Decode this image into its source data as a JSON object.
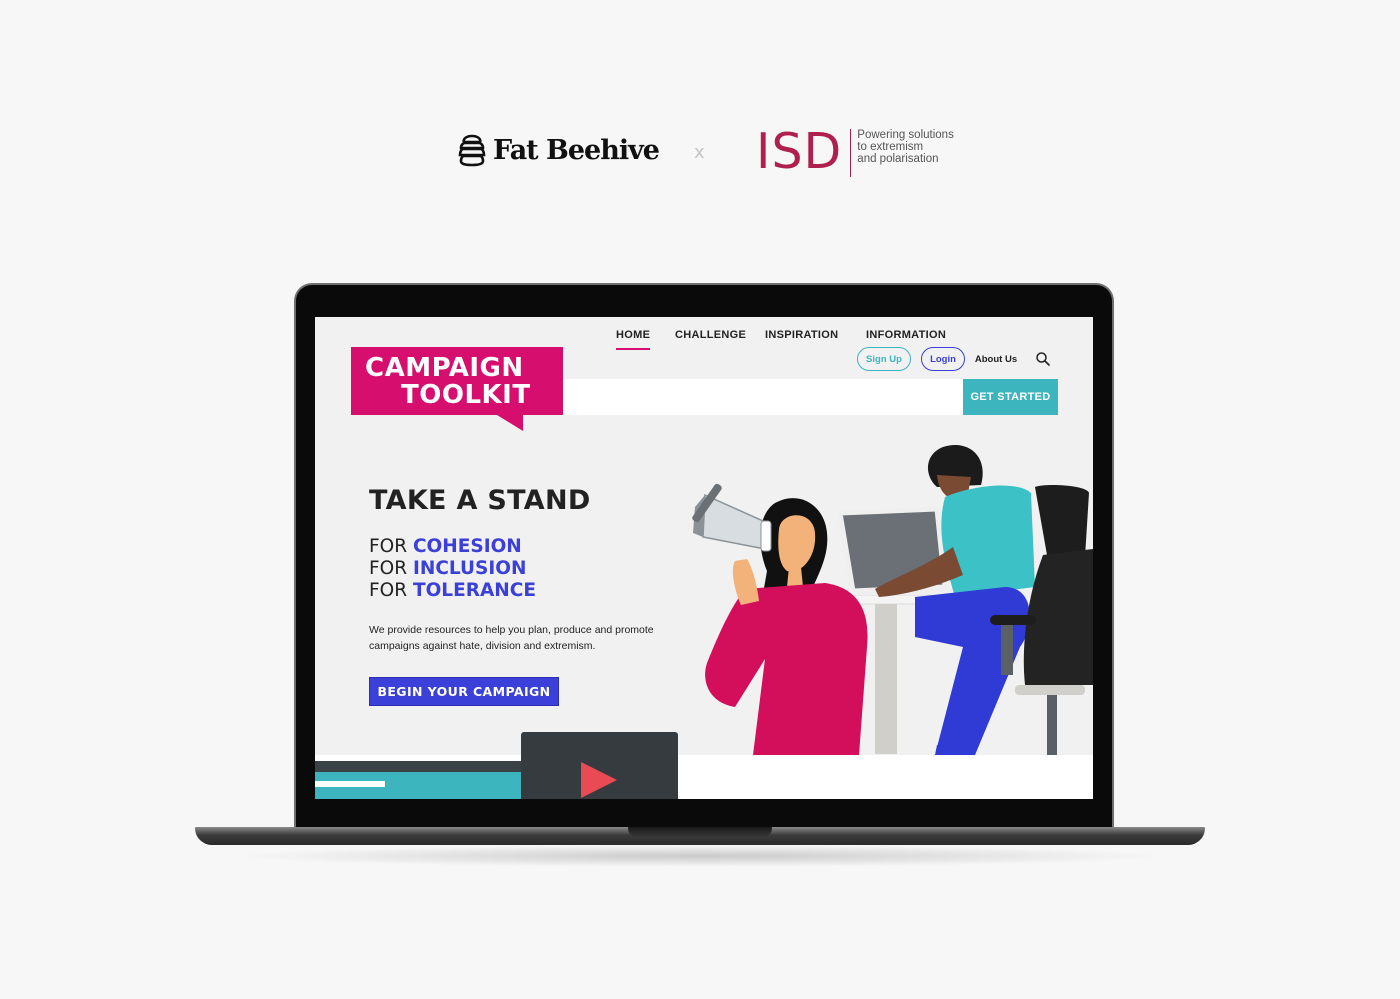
{
  "brands": {
    "fat_beehive": "Fat Beehive",
    "separator": "x",
    "isd": "ISD",
    "isd_tagline": [
      "Powering solutions",
      "to extremism",
      "and polarisation"
    ]
  },
  "site": {
    "logo_line1": "CAMPAIGN",
    "logo_line2": "TOOLKIT",
    "utility": {
      "sign_up": "Sign Up",
      "login": "Login",
      "about": "About Us"
    },
    "nav": {
      "home": "HOME",
      "challenge": "CHALLENGE",
      "inspiration": "INSPIRATION",
      "information": "INFORMATION",
      "get_started": "GET STARTED"
    },
    "hero": {
      "title": "TAKE A STAND",
      "for_prefix": "FOR",
      "keywords": [
        "COHESION",
        "INCLUSION",
        "TOLERANCE"
      ],
      "body": "We provide resources to help you plan, produce and promote campaigns against hate, division and extremism.",
      "cta": "BEGIN YOUR CAMPAIGN"
    }
  },
  "colors": {
    "brand_pink": "#d60e6e",
    "accent_blue": "#3a40d8",
    "accent_teal": "#3cb5be",
    "isd_red": "#b0204f"
  },
  "icons": {
    "search": "search-icon",
    "play": "play-icon",
    "beehive": "beehive-icon"
  }
}
